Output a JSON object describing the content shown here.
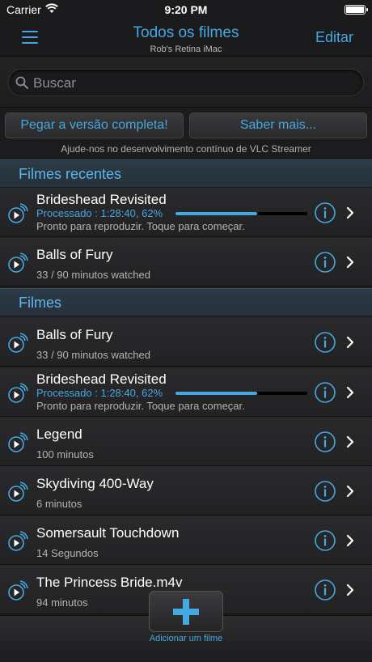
{
  "status": {
    "carrier": "Carrier",
    "time": "9:20 PM"
  },
  "nav": {
    "title": "Todos os filmes",
    "subtitle": "Rob's Retina iMac",
    "edit_label": "Editar"
  },
  "search": {
    "placeholder": "Buscar"
  },
  "promo": {
    "full_version_label": "Pegar a versão completa!",
    "learn_more_label": "Saber mais...",
    "note": "Ajude-nos no desenvolvimento contínuo de VLC Streamer"
  },
  "sections": [
    {
      "title": "Filmes recentes",
      "items": [
        {
          "title": "Brideshead Revisited",
          "processed": "Processado : 1:28:40, 62%",
          "progress": 0.62,
          "status": "Pronto para reproduzir. Toque para começar."
        },
        {
          "title": "Balls of Fury",
          "subtitle": "33 / 90 minutos watched"
        }
      ]
    },
    {
      "title": "Filmes",
      "items": [
        {
          "title": "Balls of Fury",
          "subtitle": "33 / 90 minutos watched"
        },
        {
          "title": "Brideshead Revisited",
          "processed": "Processado : 1:28:40, 62%",
          "progress": 0.62,
          "status": "Pronto para reproduzir. Toque para começar."
        },
        {
          "title": "Legend",
          "subtitle": "100 minutos"
        },
        {
          "title": "Skydiving 400-Way",
          "subtitle": "6 minutos"
        },
        {
          "title": "Somersault Touchdown",
          "subtitle": "14 Segundos"
        },
        {
          "title": "The Princess Bride.m4v",
          "subtitle": "94 minutos"
        }
      ]
    }
  ],
  "bottom": {
    "add_label": "Adicionar um filme"
  },
  "colors": {
    "accent": "#43a9e0",
    "background": "#1d1d1f"
  }
}
